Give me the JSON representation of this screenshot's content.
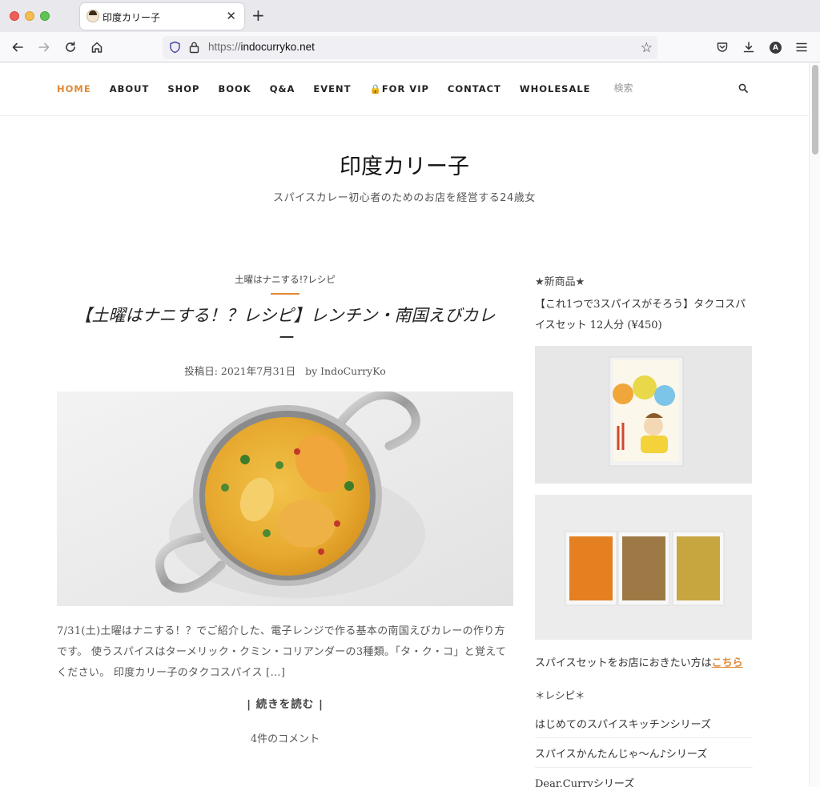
{
  "browser": {
    "tab_title": "印度カリー子",
    "url_proto": "https://",
    "url_host": "indocurryko.net"
  },
  "nav": {
    "items": [
      "HOME",
      "ABOUT",
      "SHOP",
      "BOOK",
      "Q&A",
      "EVENT",
      "🔒FOR VIP",
      "CONTACT",
      "WHOLESALE"
    ],
    "search_label": "検索"
  },
  "site": {
    "title": "印度カリー子",
    "tagline": "スパイスカレー初心者のためのお店を経営する24歳女"
  },
  "post": {
    "category": "土曜はナニする!?レシピ",
    "title": "【土曜はナニする！？レシピ】レンチン・南国えびカレー",
    "date": "投稿日: 2021年7月31日",
    "author": "by IndoCurryKo",
    "excerpt": "7/31(土)土曜はナニする！？でご紹介した、電子レンジで作る基本の南国えびカレーの作り方です。 使うスパイスはターメリック・クミン・コリアンダーの3種類。「タ・ク・コ」と覚えてください。 印度カリー子のタクコスパイス […]",
    "read_more": "| 続きを読む |",
    "comments": "4件のコメント"
  },
  "sidebar": {
    "new_heading": "★新商品★",
    "product": "【これ1つで3スパイスがそろう】タクコスパイスセット 12人分 (¥450)",
    "shop_text": "スパイスセットをお店におきたい方は",
    "shop_link": "こちら",
    "recipe_heading": "＊レシピ＊",
    "recipe_items": [
      "はじめてのスパイスキッチンシリーズ",
      "スパイスかんたんじゃ〜ん♪シリーズ",
      "Dear.Curryシリーズ"
    ]
  }
}
